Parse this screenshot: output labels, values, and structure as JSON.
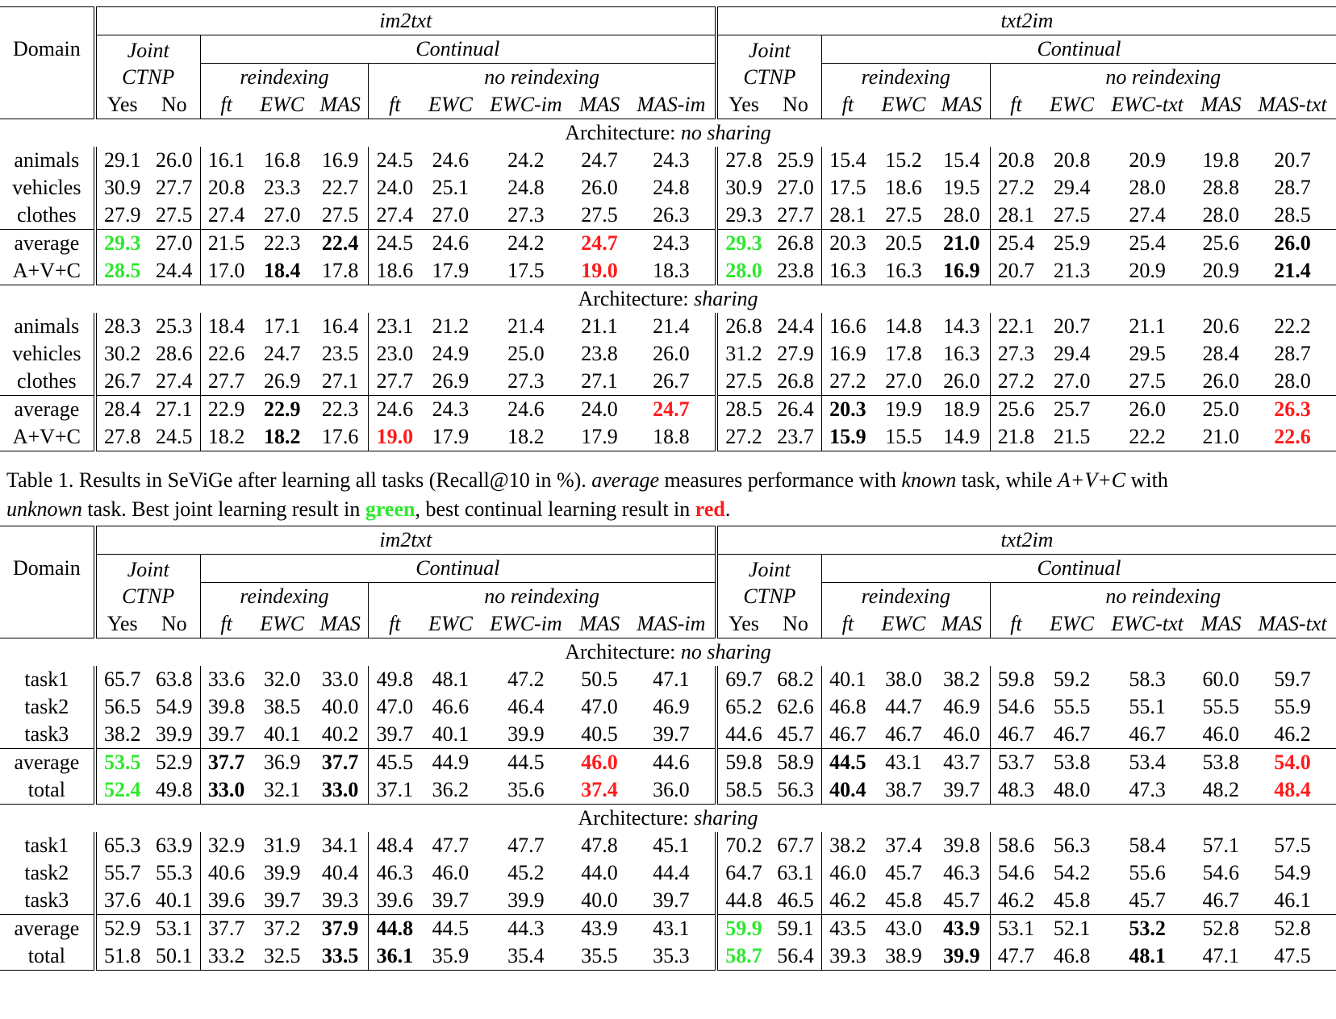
{
  "table1": {
    "header": {
      "domain": "Domain",
      "im2txt": "im2txt",
      "txt2im": "txt2im",
      "joint": "Joint",
      "ctnp": "CTNP",
      "continual": "Continual",
      "reindexing": "reindexing",
      "no_reindexing": "no reindexing",
      "cols_im": [
        "Yes",
        "No",
        "ft",
        "EWC",
        "MAS",
        "ft",
        "EWC",
        "EWC-im",
        "MAS",
        "MAS-im"
      ],
      "cols_txt": [
        "Yes",
        "No",
        "ft",
        "EWC",
        "MAS",
        "ft",
        "EWC",
        "EWC-txt",
        "MAS",
        "MAS-txt"
      ]
    },
    "sections": [
      {
        "label_prefix": "Architecture: ",
        "label_em": "no sharing",
        "rows": [
          {
            "name": "animals",
            "values": [
              "29.1",
              "26.0",
              "16.1",
              "16.8",
              "16.9",
              "24.5",
              "24.6",
              "24.2",
              "24.7",
              "24.3",
              "27.8",
              "25.9",
              "15.4",
              "15.2",
              "15.4",
              "20.8",
              "20.8",
              "20.9",
              "19.8",
              "20.7"
            ]
          },
          {
            "name": "vehicles",
            "values": [
              "30.9",
              "27.7",
              "20.8",
              "23.3",
              "22.7",
              "24.0",
              "25.1",
              "24.8",
              "26.0",
              "24.8",
              "30.9",
              "27.0",
              "17.5",
              "18.6",
              "19.5",
              "27.2",
              "29.4",
              "28.0",
              "28.8",
              "28.7"
            ]
          },
          {
            "name": "clothes",
            "values": [
              "27.9",
              "27.5",
              "27.4",
              "27.0",
              "27.5",
              "27.4",
              "27.0",
              "27.3",
              "27.5",
              "26.3",
              "29.3",
              "27.7",
              "28.1",
              "27.5",
              "28.0",
              "28.1",
              "27.5",
              "27.4",
              "28.0",
              "28.5"
            ]
          }
        ],
        "summary": [
          {
            "name": "average",
            "values": [
              "29.3",
              "27.0",
              "21.5",
              "22.3",
              "22.4",
              "24.5",
              "24.6",
              "24.2",
              "24.7",
              "24.3",
              "29.3",
              "26.8",
              "20.3",
              "20.5",
              "21.0",
              "25.4",
              "25.9",
              "25.4",
              "25.6",
              "26.0"
            ],
            "style": [
              "g",
              "",
              "",
              "",
              "b",
              "",
              "",
              "",
              "r",
              "",
              "g",
              "",
              "",
              "",
              "b",
              "",
              "",
              "",
              "",
              "b"
            ]
          },
          {
            "name": "A+V+C",
            "values": [
              "28.5",
              "24.4",
              "17.0",
              "18.4",
              "17.8",
              "18.6",
              "17.9",
              "17.5",
              "19.0",
              "18.3",
              "28.0",
              "23.8",
              "16.3",
              "16.3",
              "16.9",
              "20.7",
              "21.3",
              "20.9",
              "20.9",
              "21.4"
            ],
            "style": [
              "g",
              "",
              "",
              "b",
              "",
              "",
              "",
              "",
              "r",
              "",
              "g",
              "",
              "",
              "",
              "b",
              "",
              "",
              "",
              "",
              "b"
            ]
          }
        ]
      },
      {
        "label_prefix": "Architecture: ",
        "label_em": "sharing",
        "rows": [
          {
            "name": "animals",
            "values": [
              "28.3",
              "25.3",
              "18.4",
              "17.1",
              "16.4",
              "23.1",
              "21.2",
              "21.4",
              "21.1",
              "21.4",
              "26.8",
              "24.4",
              "16.6",
              "14.8",
              "14.3",
              "22.1",
              "20.7",
              "21.1",
              "20.6",
              "22.2"
            ]
          },
          {
            "name": "vehicles",
            "values": [
              "30.2",
              "28.6",
              "22.6",
              "24.7",
              "23.5",
              "23.0",
              "24.9",
              "25.0",
              "23.8",
              "26.0",
              "31.2",
              "27.9",
              "16.9",
              "17.8",
              "16.3",
              "27.3",
              "29.4",
              "29.5",
              "28.4",
              "28.7"
            ]
          },
          {
            "name": "clothes",
            "values": [
              "26.7",
              "27.4",
              "27.7",
              "26.9",
              "27.1",
              "27.7",
              "26.9",
              "27.3",
              "27.1",
              "26.7",
              "27.5",
              "26.8",
              "27.2",
              "27.0",
              "26.0",
              "27.2",
              "27.0",
              "27.5",
              "26.0",
              "28.0"
            ]
          }
        ],
        "summary": [
          {
            "name": "average",
            "values": [
              "28.4",
              "27.1",
              "22.9",
              "22.9",
              "22.3",
              "24.6",
              "24.3",
              "24.6",
              "24.0",
              "24.7",
              "28.5",
              "26.4",
              "20.3",
              "19.9",
              "18.9",
              "25.6",
              "25.7",
              "26.0",
              "25.0",
              "26.3"
            ],
            "style": [
              "",
              "",
              "",
              "b",
              "",
              "",
              "",
              "",
              "",
              "r",
              "",
              "",
              "b",
              "",
              "",
              "",
              "",
              "",
              "",
              "r"
            ]
          },
          {
            "name": "A+V+C",
            "values": [
              "27.8",
              "24.5",
              "18.2",
              "18.2",
              "17.6",
              "19.0",
              "17.9",
              "18.2",
              "17.9",
              "18.8",
              "27.2",
              "23.7",
              "15.9",
              "15.5",
              "14.9",
              "21.8",
              "21.5",
              "22.2",
              "21.0",
              "22.6"
            ],
            "style": [
              "",
              "",
              "",
              "b",
              "",
              "r",
              "",
              "",
              "",
              "",
              "",
              "",
              "b",
              "",
              "",
              "",
              "",
              "",
              "",
              "r"
            ]
          }
        ]
      }
    ]
  },
  "caption": {
    "part1": "Table 1. Results in SeViGe after learning all tasks (Recall@10 in %). ",
    "average_em": "average",
    "part2": " measures performance with ",
    "known_em": "known",
    "part3": " task, while ",
    "avc_em": "A+V+C",
    "part4": " with",
    "unknown_em": "unknown",
    "part5": " task. Best joint learning result in ",
    "green_word": "green",
    "part6": ", best continual learning result in ",
    "red_word": "red",
    "part7": "."
  },
  "table2": {
    "sections": [
      {
        "label_prefix": "Architecture: ",
        "label_em": "no sharing",
        "rows": [
          {
            "name": "task1",
            "values": [
              "65.7",
              "63.8",
              "33.6",
              "32.0",
              "33.0",
              "49.8",
              "48.1",
              "47.2",
              "50.5",
              "47.1",
              "69.7",
              "68.2",
              "40.1",
              "38.0",
              "38.2",
              "59.8",
              "59.2",
              "58.3",
              "60.0",
              "59.7"
            ]
          },
          {
            "name": "task2",
            "values": [
              "56.5",
              "54.9",
              "39.8",
              "38.5",
              "40.0",
              "47.0",
              "46.6",
              "46.4",
              "47.0",
              "46.9",
              "65.2",
              "62.6",
              "46.8",
              "44.7",
              "46.9",
              "54.6",
              "55.5",
              "55.1",
              "55.5",
              "55.9"
            ]
          },
          {
            "name": "task3",
            "values": [
              "38.2",
              "39.9",
              "39.7",
              "40.1",
              "40.2",
              "39.7",
              "40.1",
              "39.9",
              "40.5",
              "39.7",
              "44.6",
              "45.7",
              "46.7",
              "46.7",
              "46.0",
              "46.7",
              "46.7",
              "46.7",
              "46.0",
              "46.2"
            ]
          }
        ],
        "summary": [
          {
            "name": "average",
            "values": [
              "53.5",
              "52.9",
              "37.7",
              "36.9",
              "37.7",
              "45.5",
              "44.9",
              "44.5",
              "46.0",
              "44.6",
              "59.8",
              "58.9",
              "44.5",
              "43.1",
              "43.7",
              "53.7",
              "53.8",
              "53.4",
              "53.8",
              "54.0"
            ],
            "style": [
              "g",
              "",
              "b",
              "",
              "b",
              "",
              "",
              "",
              "r",
              "",
              "",
              "",
              "b",
              "",
              "",
              "",
              "",
              "",
              "",
              "r"
            ]
          },
          {
            "name": "total",
            "values": [
              "52.4",
              "49.8",
              "33.0",
              "32.1",
              "33.0",
              "37.1",
              "36.2",
              "35.6",
              "37.4",
              "36.0",
              "58.5",
              "56.3",
              "40.4",
              "38.7",
              "39.7",
              "48.3",
              "48.0",
              "47.3",
              "48.2",
              "48.4"
            ],
            "style": [
              "g",
              "",
              "b",
              "",
              "b",
              "",
              "",
              "",
              "r",
              "",
              "",
              "",
              "b",
              "",
              "",
              "",
              "",
              "",
              "",
              "r"
            ]
          }
        ]
      },
      {
        "label_prefix": "Architecture: ",
        "label_em": "sharing",
        "rows": [
          {
            "name": "task1",
            "values": [
              "65.3",
              "63.9",
              "32.9",
              "31.9",
              "34.1",
              "48.4",
              "47.7",
              "47.7",
              "47.8",
              "45.1",
              "70.2",
              "67.7",
              "38.2",
              "37.4",
              "39.8",
              "58.6",
              "56.3",
              "58.4",
              "57.1",
              "57.5"
            ]
          },
          {
            "name": "task2",
            "values": [
              "55.7",
              "55.3",
              "40.6",
              "39.9",
              "40.4",
              "46.3",
              "46.0",
              "45.2",
              "44.0",
              "44.4",
              "64.7",
              "63.1",
              "46.0",
              "45.7",
              "46.3",
              "54.6",
              "54.2",
              "55.6",
              "54.6",
              "54.9"
            ]
          },
          {
            "name": "task3",
            "values": [
              "37.6",
              "40.1",
              "39.6",
              "39.7",
              "39.3",
              "39.6",
              "39.7",
              "39.9",
              "40.0",
              "39.7",
              "44.8",
              "46.5",
              "46.2",
              "45.8",
              "45.7",
              "46.2",
              "45.8",
              "45.7",
              "46.7",
              "46.1"
            ]
          }
        ],
        "summary": [
          {
            "name": "average",
            "values": [
              "52.9",
              "53.1",
              "37.7",
              "37.2",
              "37.9",
              "44.8",
              "44.5",
              "44.3",
              "43.9",
              "43.1",
              "59.9",
              "59.1",
              "43.5",
              "43.0",
              "43.9",
              "53.1",
              "52.1",
              "53.2",
              "52.8",
              "52.8"
            ],
            "style": [
              "",
              "",
              "",
              "",
              "b",
              "b",
              "",
              "",
              "",
              "",
              "g",
              "",
              "",
              "",
              "b",
              "",
              "",
              "b",
              "",
              ""
            ]
          },
          {
            "name": "total",
            "values": [
              "51.8",
              "50.1",
              "33.2",
              "32.5",
              "33.5",
              "36.1",
              "35.9",
              "35.4",
              "35.5",
              "35.3",
              "58.7",
              "56.4",
              "39.3",
              "38.9",
              "39.9",
              "47.7",
              "46.8",
              "48.1",
              "47.1",
              "47.5"
            ],
            "style": [
              "",
              "",
              "",
              "",
              "b",
              "b",
              "",
              "",
              "",
              "",
              "g",
              "",
              "",
              "",
              "b",
              "",
              "",
              "b",
              "",
              ""
            ]
          }
        ]
      }
    ]
  }
}
